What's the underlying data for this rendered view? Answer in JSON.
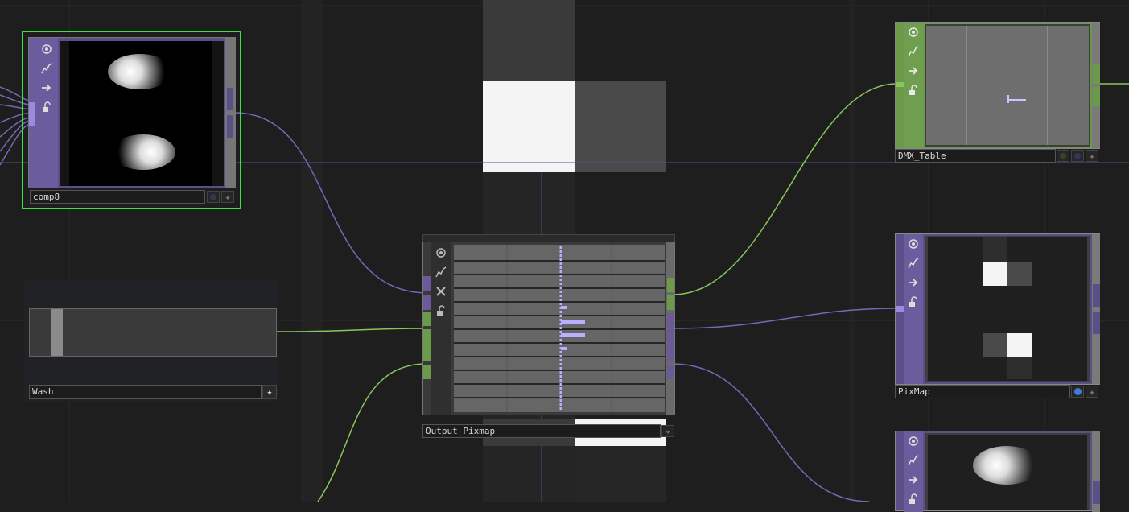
{
  "colors": {
    "background": "#1e1e1e",
    "comp_purple": "#6a5a98",
    "dat_green": "#6a9a4a",
    "selected_outline": "#3fe03f",
    "wire_purple": "#7468b8",
    "wire_green": "#86c65a",
    "flag_blue": "#3f7be0"
  },
  "nodes": {
    "comp8": {
      "name": "comp8",
      "type": "COMP",
      "selected": true
    },
    "wash": {
      "name": "Wash",
      "type": "COMP"
    },
    "output_pixmap": {
      "name": "Output_Pixmap",
      "type": "COMP"
    },
    "dmx_table": {
      "name": "DMX_Table",
      "type": "DAT"
    },
    "pixmap": {
      "name": "PixMap",
      "type": "COMP",
      "blue_flag": true
    },
    "unnamed_bottom": {
      "name": "",
      "type": "COMP"
    }
  },
  "sidebar_icons": [
    "viewer-icon",
    "cook-icon",
    "export-icon",
    "lock-icon"
  ],
  "output_pixmap_sidebar_icons": [
    "viewer-icon",
    "cook-icon",
    "bypass-x-icon",
    "lock-icon"
  ]
}
